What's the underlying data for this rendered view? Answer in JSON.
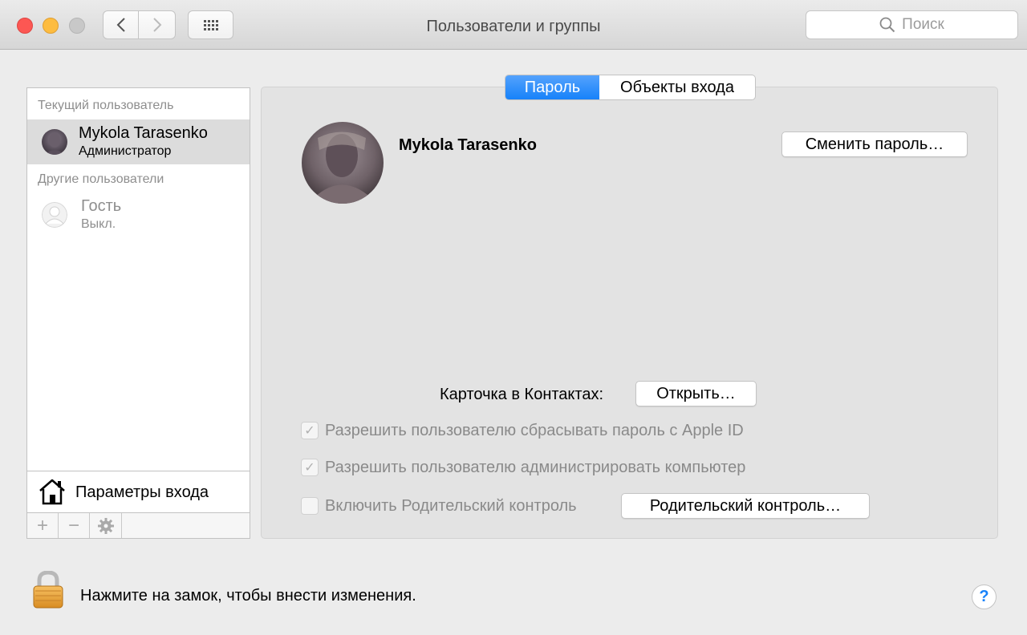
{
  "window": {
    "title": "Пользователи и группы",
    "search_placeholder": "Поиск"
  },
  "sidebar": {
    "current_section": "Текущий пользователь",
    "other_section": "Другие пользователи",
    "users": [
      {
        "name": "Mykola Tarasenko",
        "role": "Администратор"
      },
      {
        "name": "Гость",
        "role": "Выкл."
      }
    ],
    "login_options_label": "Параметры входа",
    "toolbar": {
      "add": "+",
      "remove": "−"
    }
  },
  "tabs": [
    {
      "label": "Пароль",
      "active": true
    },
    {
      "label": "Объекты входа",
      "active": false
    }
  ],
  "main": {
    "user_name": "Mykola Tarasenko",
    "change_password_button": "Сменить пароль…",
    "contacts_label": "Карточка в Контактах:",
    "open_button": "Открыть…",
    "checkboxes": [
      {
        "label": "Разрешить пользователю сбрасывать пароль с Apple ID",
        "checked": true
      },
      {
        "label": "Разрешить пользователю администрировать компьютер",
        "checked": true
      },
      {
        "label": "Включить Родительский контроль",
        "checked": false
      }
    ],
    "parental_controls_button": "Родительский контроль…"
  },
  "footer": {
    "lock_text": "Нажмите на замок, чтобы внести изменения.",
    "help": "?"
  },
  "colors": {
    "accent": "#1782fa",
    "close": "#fc5753",
    "minimize": "#fdbc40"
  }
}
